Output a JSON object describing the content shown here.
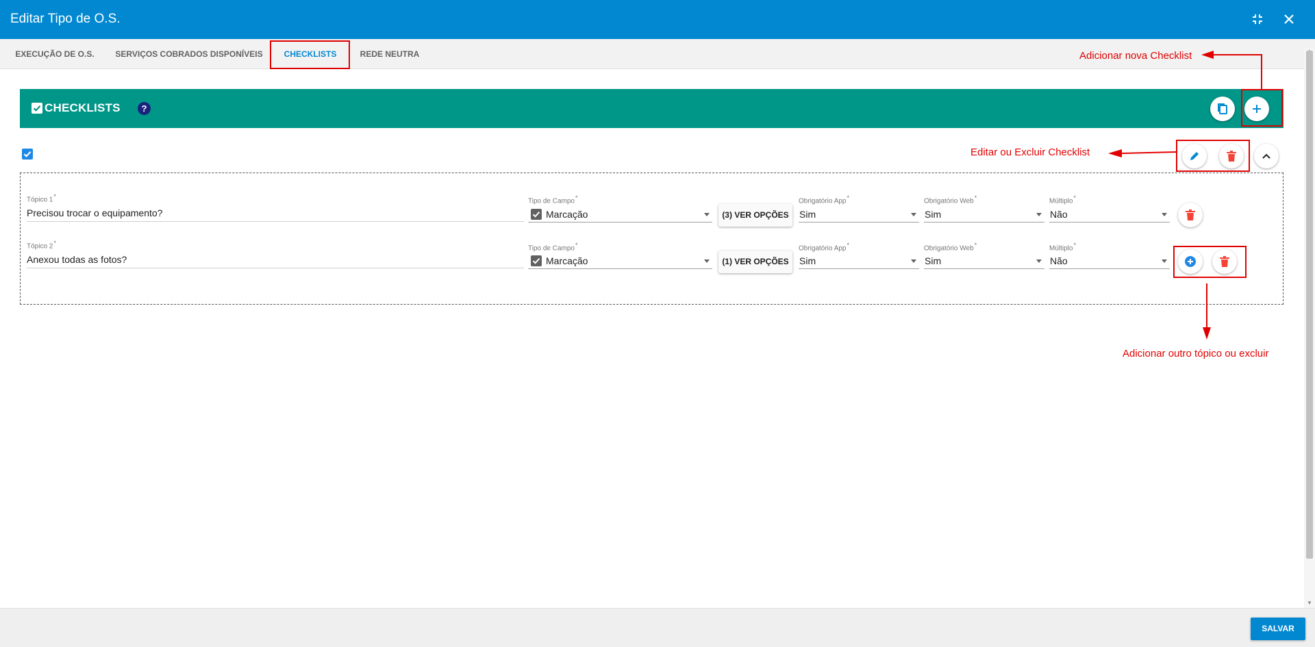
{
  "window": {
    "title": "Editar Tipo de O.S.",
    "minimize_icon": "compress-icon",
    "close_icon": "close-icon"
  },
  "tabs": [
    {
      "label": "EXECUÇÃO DE O.S.",
      "active": false
    },
    {
      "label": "SERVIÇOS COBRADOS DISPONÍVEIS",
      "active": false
    },
    {
      "label": "CHECKLISTS",
      "active": true
    },
    {
      "label": "REDE NEUTRA",
      "active": false
    }
  ],
  "banner": {
    "title": "CHECKLISTS",
    "help": "?",
    "color": "#009688"
  },
  "checklist": {
    "topics": [
      {
        "topic_label": "Tópico 1",
        "topic_value": "Precisou trocar o equipamento?",
        "field_type_label": "Tipo de Campo",
        "field_type_value": "Marcação",
        "options_button": "(3) VER OPÇÕES",
        "app_label": "Obrigatório App",
        "app_value": "Sim",
        "web_label": "Obrigatório Web",
        "web_value": "Sim",
        "multi_label": "Múltiplo",
        "multi_value": "Não"
      },
      {
        "topic_label": "Tópico 2",
        "topic_value": "Anexou todas as fotos?",
        "field_type_label": "Tipo de Campo",
        "field_type_value": "Marcação",
        "options_button": "(1) VER OPÇÕES",
        "app_label": "Obrigatório App",
        "app_value": "Sim",
        "web_label": "Obrigatório Web",
        "web_value": "Sim",
        "multi_label": "Múltiplo",
        "multi_value": "Não"
      }
    ],
    "required_mark": "*"
  },
  "annotations": {
    "add_checklist": "Adicionar nova Checklist",
    "edit_delete": "Editar ou Excluir Checklist",
    "add_topic": "Adicionar outro tópico ou excluir",
    "color": "#e00000"
  },
  "footer": {
    "save_label": "SALVAR"
  },
  "colors": {
    "primary": "#0288d1",
    "danger": "#f44336",
    "accent_blue": "#1e88e5"
  }
}
